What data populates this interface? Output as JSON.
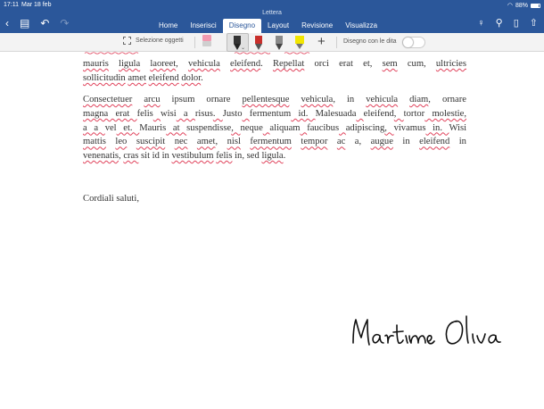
{
  "status": {
    "time": "17:11",
    "date": "Mar 18 feb",
    "battery": "88%"
  },
  "document": {
    "title": "Lettera"
  },
  "tabs": [
    {
      "label": "Home",
      "active": false
    },
    {
      "label": "Inserisci",
      "active": false
    },
    {
      "label": "Disegno",
      "active": true
    },
    {
      "label": "Layout",
      "active": false
    },
    {
      "label": "Revisione",
      "active": false
    },
    {
      "label": "Visualizza",
      "active": false
    }
  ],
  "toolbar": {
    "select_objects": "Selezione oggetti",
    "finger_drawing": "Disegno con le dita",
    "finger_drawing_on": false,
    "pens": [
      {
        "name": "black-pen",
        "color": "#333333"
      },
      {
        "name": "red-pen",
        "color": "#c9302c"
      },
      {
        "name": "gray-pencil",
        "color": "#8a8a8a"
      },
      {
        "name": "yellow-highlighter",
        "color": "#f2e600"
      }
    ]
  },
  "body": {
    "p1": [
      [
        "mauris",
        " ",
        "ligula",
        "  ",
        "laoreet",
        ", ",
        "vehicula",
        " ",
        "eleifend",
        ". ",
        "Repellat",
        " orci erat et, ",
        "sem",
        " cum, ",
        "ultricies"
      ],
      [
        "sollicitudin",
        " ",
        "amet",
        " ",
        "eleifend",
        " ",
        "dolor",
        "."
      ]
    ],
    "p2": [
      [
        "Consectetuer",
        " ",
        "arcu",
        " ipsum ornare ",
        "pellentesque",
        " ",
        "vehicula",
        ", in ",
        "vehicula",
        " ",
        "diam",
        ", ornare"
      ],
      [
        "magna erat ",
        "felis",
        " ",
        "wisi",
        " a ",
        "risus",
        ". ",
        "Justo",
        " ",
        "fermentum",
        " id. ",
        "Malesuada",
        " ",
        "eleifend",
        ", ",
        "tortor",
        " molestie,"
      ],
      [
        "a a ",
        "vel",
        " et. ",
        "Mauris",
        " at ",
        "suspendisse",
        ", ",
        "neque",
        " ",
        "aliquam",
        " ",
        "faucibus",
        " ",
        "adipiscing",
        ", ",
        "vivamus",
        " in. ",
        "Wisi"
      ],
      [
        "mattis",
        " ",
        "leo",
        " ",
        "suscipit",
        " ",
        "nec",
        " ",
        "amet",
        ", ",
        "nisl",
        " ",
        "fermentum",
        " ",
        "tempor",
        " ",
        "ac",
        " a, ",
        "augue",
        " in ",
        "eleifend",
        " in"
      ],
      [
        "venenatis",
        ", ",
        "cras",
        " sit id in ",
        "vestibulum",
        " ",
        "felis",
        " in, sed ",
        "ligula",
        "."
      ]
    ],
    "closing": "Cordiali saluti,"
  },
  "signature": "Martina Oliva",
  "colors": {
    "ribbon": "#2b579a",
    "spell_underline": "#e0425b"
  }
}
